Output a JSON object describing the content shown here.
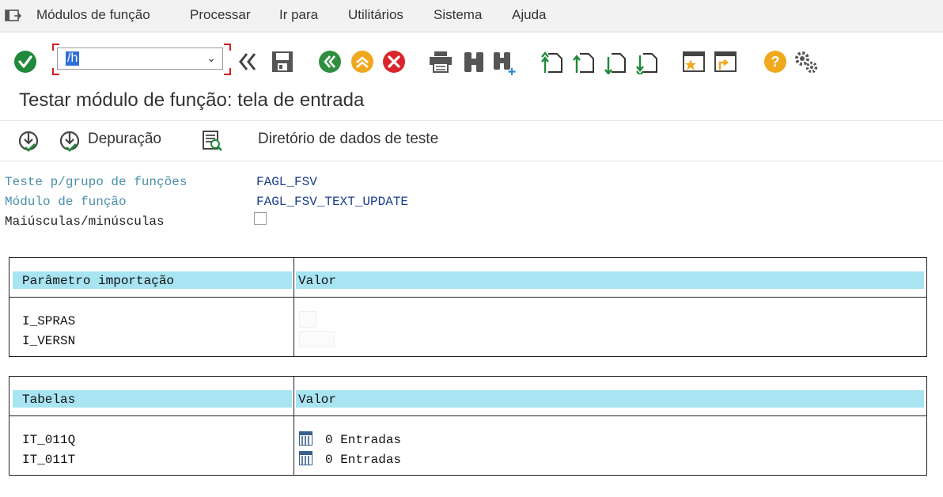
{
  "menubar": {
    "items": [
      "Módulos de função",
      "Processar",
      "Ir para",
      "Utilitários",
      "Sistema",
      "Ajuda"
    ]
  },
  "toolbar": {
    "command_field_value": "/h",
    "icons": [
      "enter-icon",
      "back-double-icon",
      "save-icon",
      "back-icon",
      "exit-icon",
      "cancel-icon",
      "print-icon",
      "find-icon",
      "find-next-icon",
      "first-page-icon",
      "previous-page-icon",
      "next-page-icon",
      "last-page-icon",
      "create-shortcut-icon",
      "session-icon",
      "help-icon",
      "customize-layout-icon"
    ]
  },
  "page": {
    "title": "Testar módulo de função: tela de entrada"
  },
  "app_toolbar": {
    "debug_label": "Depuração",
    "test_data_label": "Diretório de dados de teste"
  },
  "header_fields": {
    "group_label": "Teste p/grupo de funções",
    "group_value": "FAGL_FSV",
    "module_label": "Módulo de função",
    "module_value": "FAGL_FSV_TEXT_UPDATE",
    "case_label": "Maiúsculas/minúsculas",
    "case_checked": false
  },
  "import_table": {
    "col1": "Parâmetro importação",
    "col2": "Valor",
    "rows": [
      {
        "name": "I_SPRAS",
        "value": ""
      },
      {
        "name": "I_VERSN",
        "value": ""
      }
    ]
  },
  "tables_table": {
    "col1": "Tabelas",
    "col2": "Valor",
    "rows": [
      {
        "name": "IT_011Q",
        "value": "0 Entradas"
      },
      {
        "name": "IT_011T",
        "value": "0 Entradas"
      }
    ]
  }
}
